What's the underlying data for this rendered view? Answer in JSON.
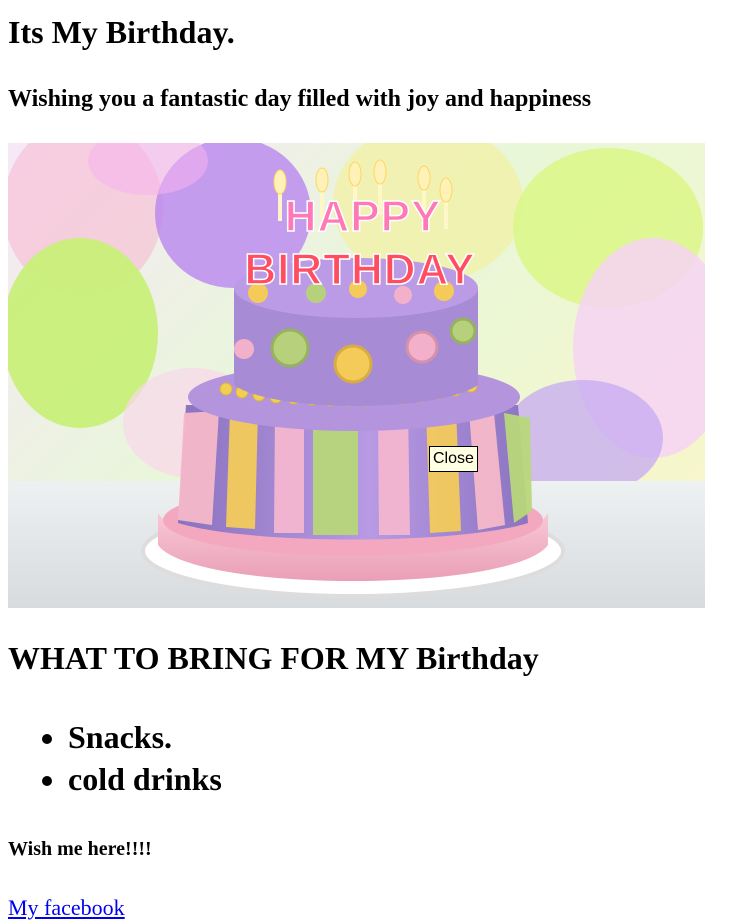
{
  "page": {
    "heading": "Its My Birthday.",
    "subtitle": "Wishing you a fantastic day filled with joy and happiness",
    "section_heading": "WHAT TO BRING FOR MY Birthday",
    "bring_list": [
      "Snacks.",
      "cold drinks"
    ],
    "wish_text": "Wish me here!!!!",
    "facebook_link_text": "My facebook"
  },
  "image": {
    "letters_top": "HAPPY",
    "letters_bottom": "BIRTHDAY",
    "tooltip": "Close"
  },
  "colors": {
    "link": "#0000ee",
    "tooltip_bg": "#ffffe1",
    "cake_purple": "#a98bd8",
    "cake_pink": "#f4b3c7",
    "cake_yellow": "#f7cf62",
    "cake_green": "#b9d77b"
  }
}
